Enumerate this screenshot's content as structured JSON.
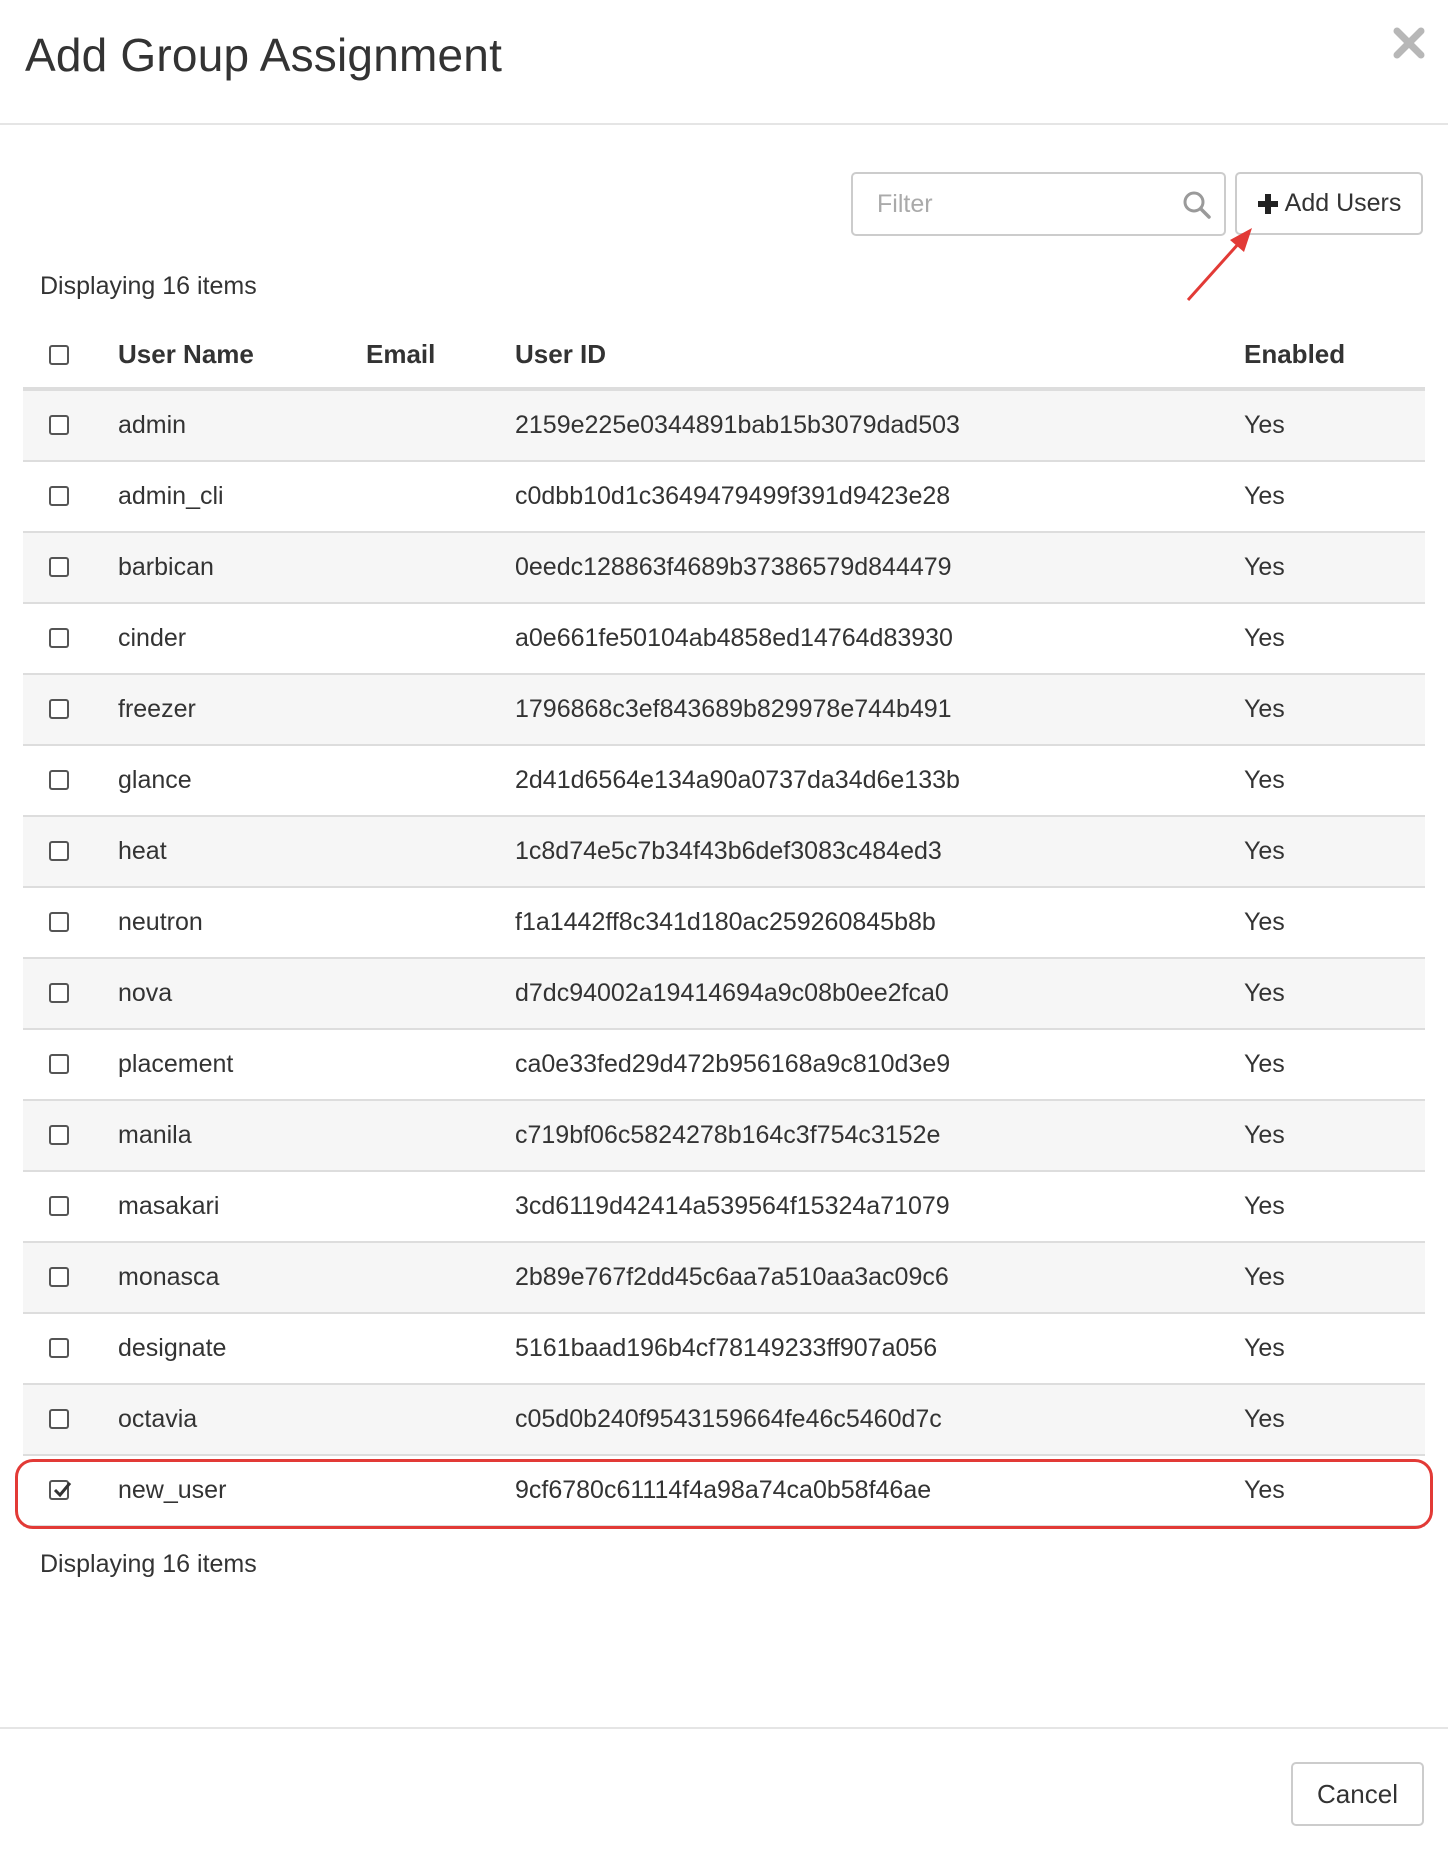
{
  "modal": {
    "title": "Add Group Assignment",
    "close_icon": "close-icon"
  },
  "toolbar": {
    "filter_placeholder": "Filter",
    "filter_value": "",
    "search_icon": "search-icon",
    "add_users_label": "Add Users",
    "add_users_icon": "plus-icon"
  },
  "table": {
    "count_top": "Displaying 16 items",
    "count_bottom": "Displaying 16 items",
    "headers": {
      "user_name": "User Name",
      "email": "Email",
      "user_id": "User ID",
      "enabled": "Enabled"
    },
    "rows": [
      {
        "name": "admin",
        "email": "",
        "id": "2159e225e0344891bab15b3079dad503",
        "enabled": "Yes",
        "checked": false
      },
      {
        "name": "admin_cli",
        "email": "",
        "id": "c0dbb10d1c3649479499f391d9423e28",
        "enabled": "Yes",
        "checked": false
      },
      {
        "name": "barbican",
        "email": "",
        "id": "0eedc128863f4689b37386579d844479",
        "enabled": "Yes",
        "checked": false
      },
      {
        "name": "cinder",
        "email": "",
        "id": "a0e661fe50104ab4858ed14764d83930",
        "enabled": "Yes",
        "checked": false
      },
      {
        "name": "freezer",
        "email": "",
        "id": "1796868c3ef843689b829978e744b491",
        "enabled": "Yes",
        "checked": false
      },
      {
        "name": "glance",
        "email": "",
        "id": "2d41d6564e134a90a0737da34d6e133b",
        "enabled": "Yes",
        "checked": false
      },
      {
        "name": "heat",
        "email": "",
        "id": "1c8d74e5c7b34f43b6def3083c484ed3",
        "enabled": "Yes",
        "checked": false
      },
      {
        "name": "neutron",
        "email": "",
        "id": "f1a1442ff8c341d180ac259260845b8b",
        "enabled": "Yes",
        "checked": false
      },
      {
        "name": "nova",
        "email": "",
        "id": "d7dc94002a19414694a9c08b0ee2fca0",
        "enabled": "Yes",
        "checked": false
      },
      {
        "name": "placement",
        "email": "",
        "id": "ca0e33fed29d472b956168a9c810d3e9",
        "enabled": "Yes",
        "checked": false
      },
      {
        "name": "manila",
        "email": "",
        "id": "c719bf06c5824278b164c3f754c3152e",
        "enabled": "Yes",
        "checked": false
      },
      {
        "name": "masakari",
        "email": "",
        "id": "3cd6119d42414a539564f15324a71079",
        "enabled": "Yes",
        "checked": false
      },
      {
        "name": "monasca",
        "email": "",
        "id": "2b89e767f2dd45c6aa7a510aa3ac09c6",
        "enabled": "Yes",
        "checked": false
      },
      {
        "name": "designate",
        "email": "",
        "id": "5161baad196b4cf78149233ff907a056",
        "enabled": "Yes",
        "checked": false
      },
      {
        "name": "octavia",
        "email": "",
        "id": "c05d0b240f9543159664fe46c5460d7c",
        "enabled": "Yes",
        "checked": false
      },
      {
        "name": "new_user",
        "email": "",
        "id": "9cf6780c61114f4a98a74ca0b58f46ae",
        "enabled": "Yes",
        "checked": true
      }
    ]
  },
  "footer": {
    "cancel_label": "Cancel"
  },
  "colors": {
    "annotation": "#e23a36",
    "border": "#dddddd",
    "stripe": "#f6f6f6",
    "text": "#333333"
  }
}
